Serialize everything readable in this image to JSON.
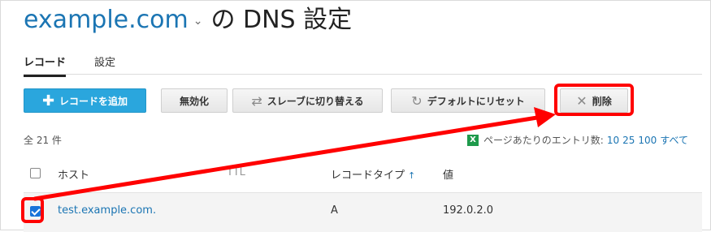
{
  "header": {
    "domain": "example.com",
    "suffix": "の DNS 設定"
  },
  "tabs": [
    {
      "label": "レコード",
      "active": true
    },
    {
      "label": "設定",
      "active": false
    }
  ],
  "toolbar": {
    "add": "レコードを追加",
    "disable": "無効化",
    "switch_slave": "スレーブに切り替える",
    "reset": "デフォルトにリセット",
    "delete": "削除"
  },
  "list": {
    "total": "全 21 件",
    "per_page_label": "ページあたりのエントリ数:",
    "per_page_options": [
      "10",
      "25",
      "100",
      "すべて"
    ]
  },
  "table": {
    "columns": {
      "host": "ホスト",
      "ttl": "TTL",
      "type": "レコードタイプ",
      "value": "値"
    },
    "rows": [
      {
        "host": "test.example.com.",
        "ttl": "",
        "type": "A",
        "value": "192.0.2.0",
        "checked": true
      }
    ]
  },
  "colors": {
    "accent": "#1b75b3",
    "primary_button": "#2aa6dd",
    "highlight": "#ff0000",
    "checkbox_checked": "#1a73d9"
  }
}
